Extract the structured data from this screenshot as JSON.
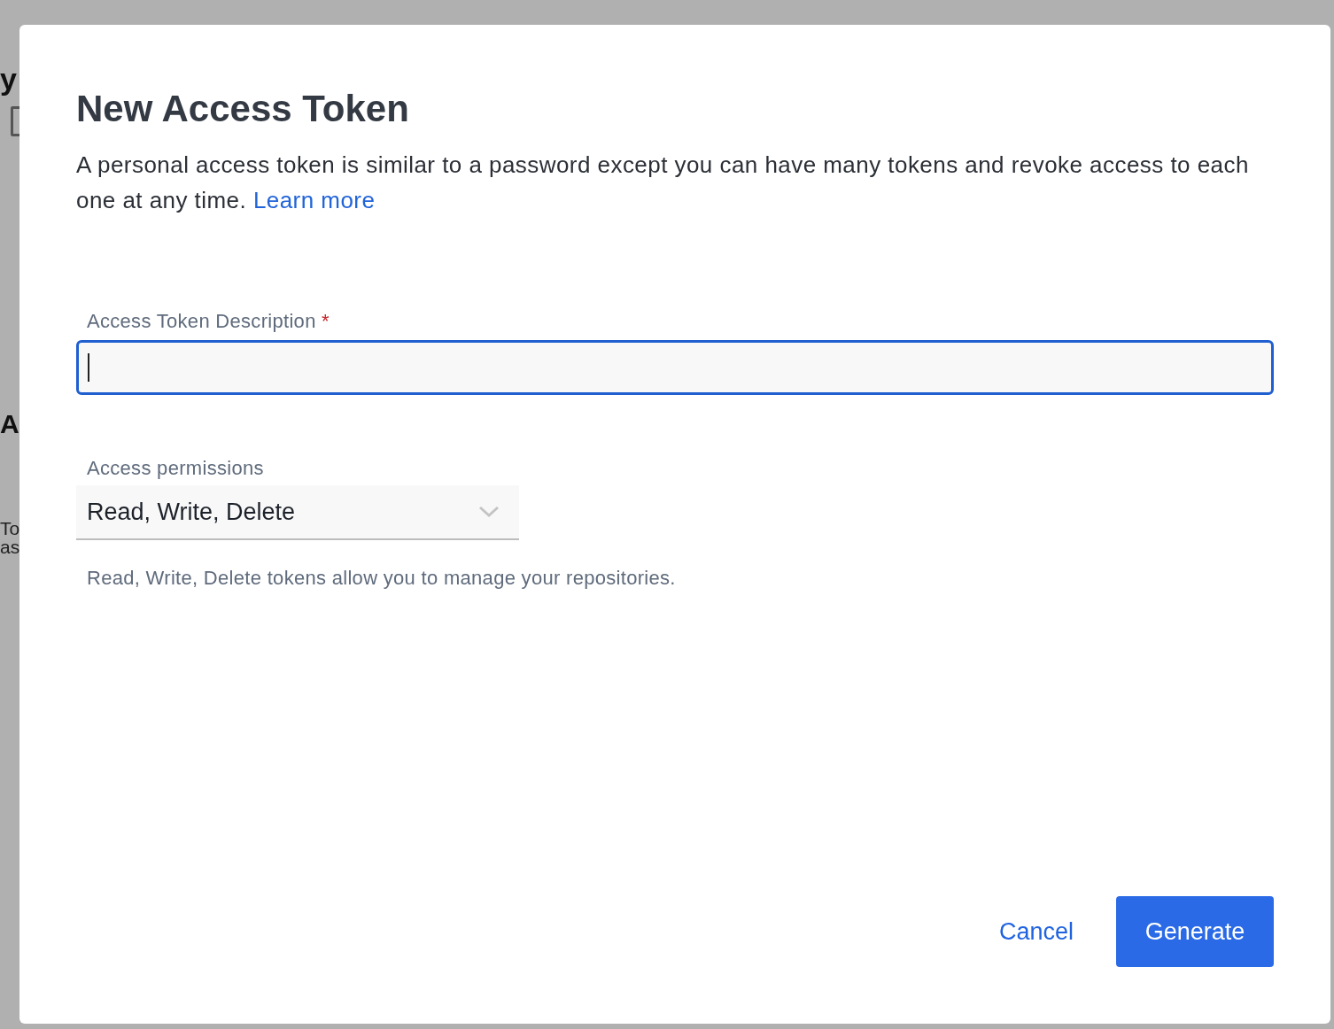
{
  "background_page": {
    "fragments": [
      "y",
      "A",
      "To",
      "as"
    ]
  },
  "dialog": {
    "title": "New Access Token",
    "description": "A personal access token is similar to a password except you can have many tokens and revoke access to each one at any time.",
    "learn_more_link": "Learn more",
    "description_field": {
      "label": "Access Token Description",
      "required": true,
      "required_marker": "*",
      "focused": true
    },
    "permissions_field": {
      "label": "Access permissions",
      "value": "Read, Write, Delete"
    },
    "helper_text": "Read, Write, Delete tokens allow you to manage your repositories.",
    "buttons": [
      {
        "label": "Cancel",
        "kind": "text"
      },
      {
        "label": "Generate",
        "kind": "primary"
      }
    ]
  }
}
